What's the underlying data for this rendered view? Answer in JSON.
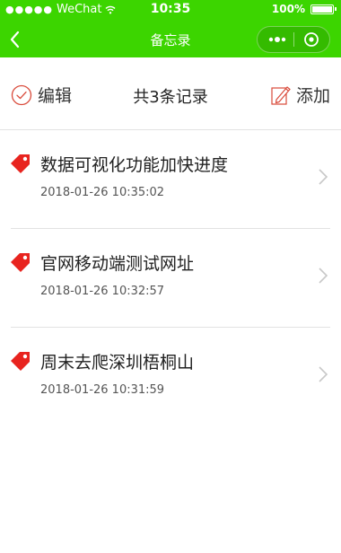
{
  "status_bar": {
    "signal": "●●●●●",
    "carrier": "WeChat",
    "time": "10:35",
    "battery": "100%"
  },
  "nav": {
    "title": "备忘录",
    "back_icon": "chevron-left-icon",
    "more_icon": "more-dots-icon",
    "close_icon": "target-close-icon"
  },
  "toolbar": {
    "edit_label": "编辑",
    "count_label": "共3条记录",
    "add_label": "添加"
  },
  "items": [
    {
      "title": "数据可视化功能加快进度",
      "date": "2018-01-26 10:35:02"
    },
    {
      "title": "官网移动端测试网址",
      "date": "2018-01-26 10:32:57"
    },
    {
      "title": "周末去爬深圳梧桐山",
      "date": "2018-01-26 10:31:59"
    }
  ],
  "colors": {
    "header": "#3cd500",
    "tag": "#e8241f",
    "accent_circle": "#d94a3a",
    "text": "#222222",
    "date": "#555555"
  }
}
